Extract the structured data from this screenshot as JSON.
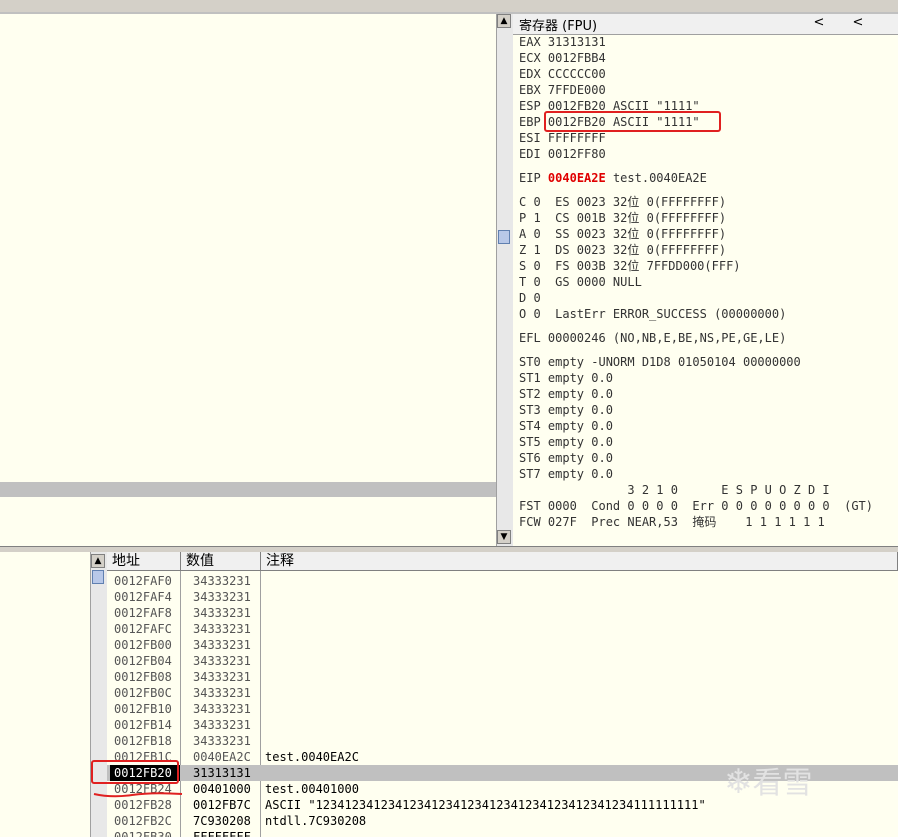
{
  "registers_panel": {
    "title": "寄存器 (FPU)",
    "nav_left_1": "<",
    "nav_left_2": "<",
    "general": [
      {
        "name": "EAX",
        "value": "31313131",
        "comment": ""
      },
      {
        "name": "ECX",
        "value": "0012FBB4",
        "comment": ""
      },
      {
        "name": "EDX",
        "value": "CCCCCC00",
        "comment": ""
      },
      {
        "name": "EBX",
        "value": "7FFDE000",
        "comment": ""
      },
      {
        "name": "ESP",
        "value": "0012FB20",
        "comment": "ASCII \"1111\""
      },
      {
        "name": "EBP",
        "value": "0012FB20",
        "comment": "ASCII \"1111\""
      },
      {
        "name": "ESI",
        "value": "FFFFFFFF",
        "comment": ""
      },
      {
        "name": "EDI",
        "value": "0012FF80",
        "comment": ""
      }
    ],
    "eip": {
      "name": "EIP",
      "value": "0040EA2E",
      "comment": "test.0040EA2E"
    },
    "flags": [
      "C 0  ES 0023 32位 0(FFFFFFFF)",
      "P 1  CS 001B 32位 0(FFFFFFFF)",
      "A 0  SS 0023 32位 0(FFFFFFFF)",
      "Z 1  DS 0023 32位 0(FFFFFFFF)",
      "S 0  FS 003B 32位 7FFDD000(FFF)",
      "T 0  GS 0000 NULL",
      "D 0",
      "O 0  LastErr ERROR_SUCCESS (00000000)"
    ],
    "efl": "EFL 00000246 (NO,NB,E,BE,NS,PE,GE,LE)",
    "fpu": [
      "ST0 empty -UNORM D1D8 01050104 00000000",
      "ST1 empty 0.0",
      "ST2 empty 0.0",
      "ST3 empty 0.0",
      "ST4 empty 0.0",
      "ST5 empty 0.0",
      "ST6 empty 0.0",
      "ST7 empty 0.0"
    ],
    "fpu_bits_header": "               3 2 1 0      E S P U O Z D I",
    "fst_line": "FST 0000  Cond 0 0 0 0  Err 0 0 0 0 0 0 0 0  (GT)",
    "fcw_line": "FCW 027F  Prec NEAR,53  掩码    1 1 1 1 1 1"
  },
  "stack_panel": {
    "columns": {
      "address": "地址",
      "value": "数值",
      "comment": "注释"
    },
    "rows": [
      {
        "addr": "0012FAF0",
        "val": "34333231",
        "cmt": ""
      },
      {
        "addr": "0012FAF4",
        "val": "34333231",
        "cmt": ""
      },
      {
        "addr": "0012FAF8",
        "val": "34333231",
        "cmt": ""
      },
      {
        "addr": "0012FAFC",
        "val": "34333231",
        "cmt": ""
      },
      {
        "addr": "0012FB00",
        "val": "34333231",
        "cmt": ""
      },
      {
        "addr": "0012FB04",
        "val": "34333231",
        "cmt": ""
      },
      {
        "addr": "0012FB08",
        "val": "34333231",
        "cmt": ""
      },
      {
        "addr": "0012FB0C",
        "val": "34333231",
        "cmt": ""
      },
      {
        "addr": "0012FB10",
        "val": "34333231",
        "cmt": ""
      },
      {
        "addr": "0012FB14",
        "val": "34333231",
        "cmt": ""
      },
      {
        "addr": "0012FB18",
        "val": "34333231",
        "cmt": ""
      },
      {
        "addr": "0012FB1C",
        "val": "0040EA2C",
        "cmt": "test.0040EA2C"
      },
      {
        "addr": "0012FB20",
        "val": "31313131",
        "cmt": ""
      },
      {
        "addr": "0012FB24",
        "val": "00401000",
        "cmt": "test.00401000"
      },
      {
        "addr": "0012FB28",
        "val": "0012FB7C",
        "cmt": "ASCII \"12341234123412341234123412341234123412341234111111111\""
      },
      {
        "addr": "0012FB2C",
        "val": "7C930208",
        "cmt": "ntdll.7C930208"
      },
      {
        "addr": "0012FB30",
        "val": "FFFFFFFF",
        "cmt": ""
      }
    ]
  },
  "watermark": "看雪"
}
